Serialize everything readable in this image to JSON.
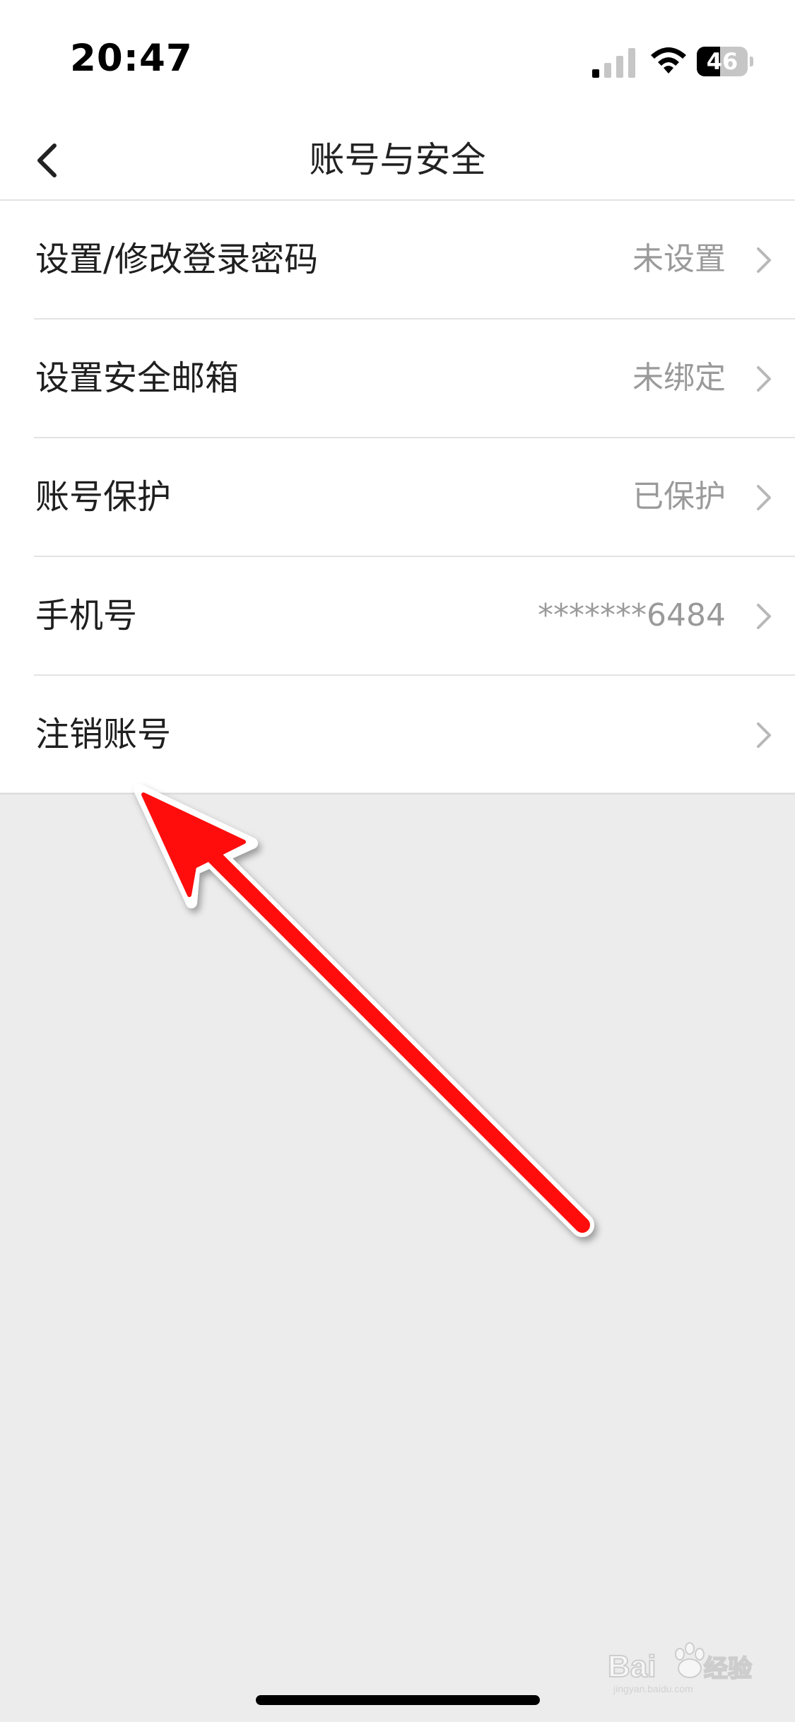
{
  "status_bar": {
    "time": "20:47",
    "battery_level": "46",
    "signal_icon": "cellular-signal-icon",
    "wifi_icon": "wifi-icon"
  },
  "nav": {
    "title": "账号与安全",
    "back_icon": "chevron-left-icon"
  },
  "menu": {
    "items": [
      {
        "label": "设置/修改登录密码",
        "value": "未设置"
      },
      {
        "label": "设置安全邮箱",
        "value": "未绑定"
      },
      {
        "label": "账号保护",
        "value": "已保护"
      },
      {
        "label": "手机号",
        "value": "*******6484"
      },
      {
        "label": "注销账号",
        "value": ""
      }
    ],
    "chevron_icon": "chevron-right-icon"
  },
  "watermark": {
    "text": "Bai 经验",
    "subtext": "jingyan.baidu.com"
  },
  "colors": {
    "background": "#ececec",
    "surface": "#ffffff",
    "annotation_arrow": "#ff0000",
    "secondary_text": "#9a9a9a"
  }
}
